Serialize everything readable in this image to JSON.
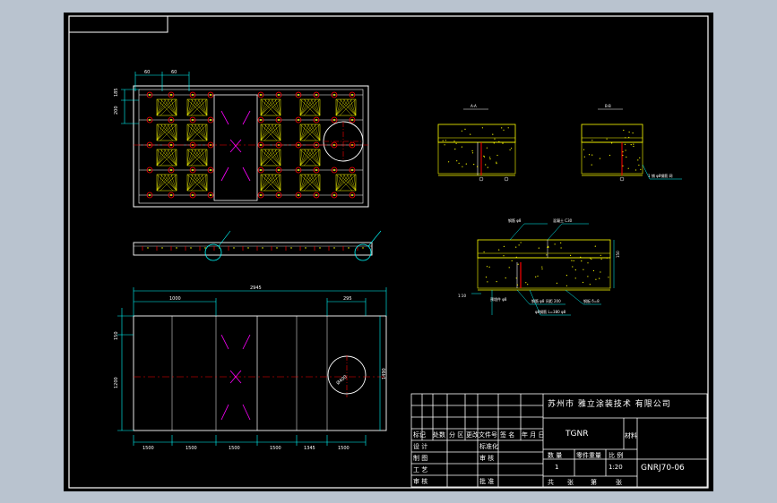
{
  "title_block": {
    "company": "苏州市 雅立涂装技术 有限公司",
    "part_name": "TGNR",
    "drawing_no": "GNRJ70-06",
    "scale": "1:20",
    "quantity": "1",
    "rows_left": [
      "设 计",
      "制 图",
      "工 艺",
      "审 核"
    ],
    "rows_mid": [
      "标准化",
      "审 核",
      "",
      "批 准"
    ],
    "header_cells": [
      "标记",
      "处数",
      "分 区",
      "更改文件号",
      "签 名",
      "年 月 日"
    ],
    "col_headers": [
      "数 量",
      "零件重量",
      "比 例"
    ],
    "sheet_label": [
      "共",
      "张",
      "第",
      "张"
    ],
    "material_label": "材料"
  },
  "dimensions": {
    "top_dims": [
      "60",
      "60"
    ],
    "left_dims": [
      "185",
      "200"
    ],
    "bottom_total": "2945",
    "bottom_left": "1000",
    "bottom_right": "295",
    "bottom_left_v1": "150",
    "bottom_left_v2": "1200",
    "bottom_right_v": "1490",
    "bottom_segments": [
      "1500",
      "1500",
      "1500",
      "1500",
      "1345",
      "1500"
    ],
    "circle_dia": "Ø400"
  },
  "section_labels": {
    "sec1_tag": "A-A",
    "sec2_tag": "B-B",
    "sec2_note": "1 铺 φ8钢筋 网",
    "sec3_top_left": "钢筋 φ8",
    "sec3_top_right": "混凝土 C30",
    "sec3_right_v": "150",
    "sec3_note1": "预埋件 φ8",
    "sec3_note2": "钢筋 φ8 间距 200",
    "sec3_note3": "φ8钢筋 L=380 φ8",
    "sec3_note4": "钢板 δ=8",
    "sec3_left": "1:10"
  },
  "colors": {
    "frame": "#ffffff",
    "accent": "#00ffff",
    "highlight": "#ffff00",
    "marker": "#ff0000",
    "magenta": "#ff00ff"
  }
}
